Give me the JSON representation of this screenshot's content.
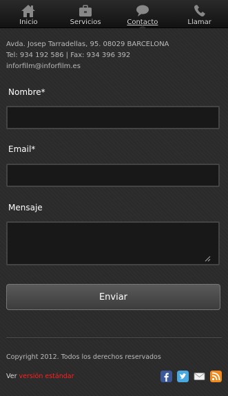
{
  "nav": {
    "items": [
      {
        "label": "Inicio",
        "icon": "home-icon"
      },
      {
        "label": "Servicios",
        "icon": "briefcase-icon"
      },
      {
        "label": "Contacto",
        "icon": "speech-bubble-icon"
      },
      {
        "label": "Llamar",
        "icon": "phone-icon"
      }
    ],
    "active": "Contacto"
  },
  "contact": {
    "address": "Avda. Josep Tarradellas, 95. 08029 BARCELONA",
    "phones": "Tel: 934 192 586 | Fax: 934 396 392",
    "email": "inforfilm@inforfilm.es"
  },
  "form": {
    "name_label": "Nombre*",
    "name_value": "",
    "email_label": "Email*",
    "email_value": "",
    "message_label": "Mensaje",
    "message_value": "",
    "submit_label": "Enviar"
  },
  "footer": {
    "copyright": "Copyright 2012. Todos los derechos reservados",
    "version_prefix": "Ver",
    "version_link": "versión estándar",
    "social": [
      "facebook-icon",
      "twitter-icon",
      "mail-icon",
      "rss-icon"
    ]
  },
  "colors": {
    "background": "#2b2b2b",
    "accent_link": "#ff2020",
    "facebook": "#3b5998",
    "twitter": "#4aa8e0",
    "rss": "#f28a1b"
  }
}
